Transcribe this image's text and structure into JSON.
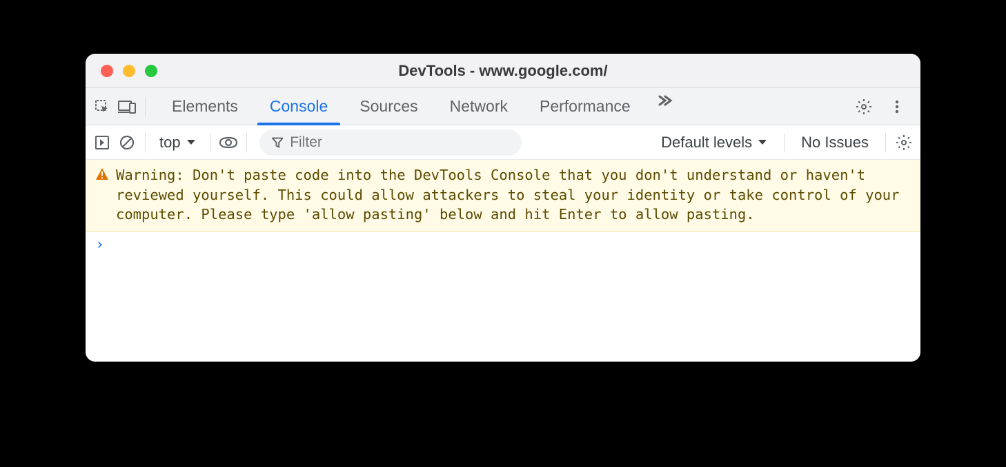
{
  "window": {
    "title": "DevTools - www.google.com/"
  },
  "tabstrip": {
    "tabs": [
      "Elements",
      "Console",
      "Sources",
      "Network",
      "Performance"
    ],
    "active_index": 1
  },
  "toolbar": {
    "context": "top",
    "filter_placeholder": "Filter",
    "levels_label": "Default levels",
    "issues_label": "No Issues"
  },
  "console": {
    "warning": "Warning: Don't paste code into the DevTools Console that you don't understand or haven't reviewed yourself. This could allow attackers to steal your identity or take control of your computer. Please type 'allow pasting' below and hit Enter to allow pasting."
  }
}
